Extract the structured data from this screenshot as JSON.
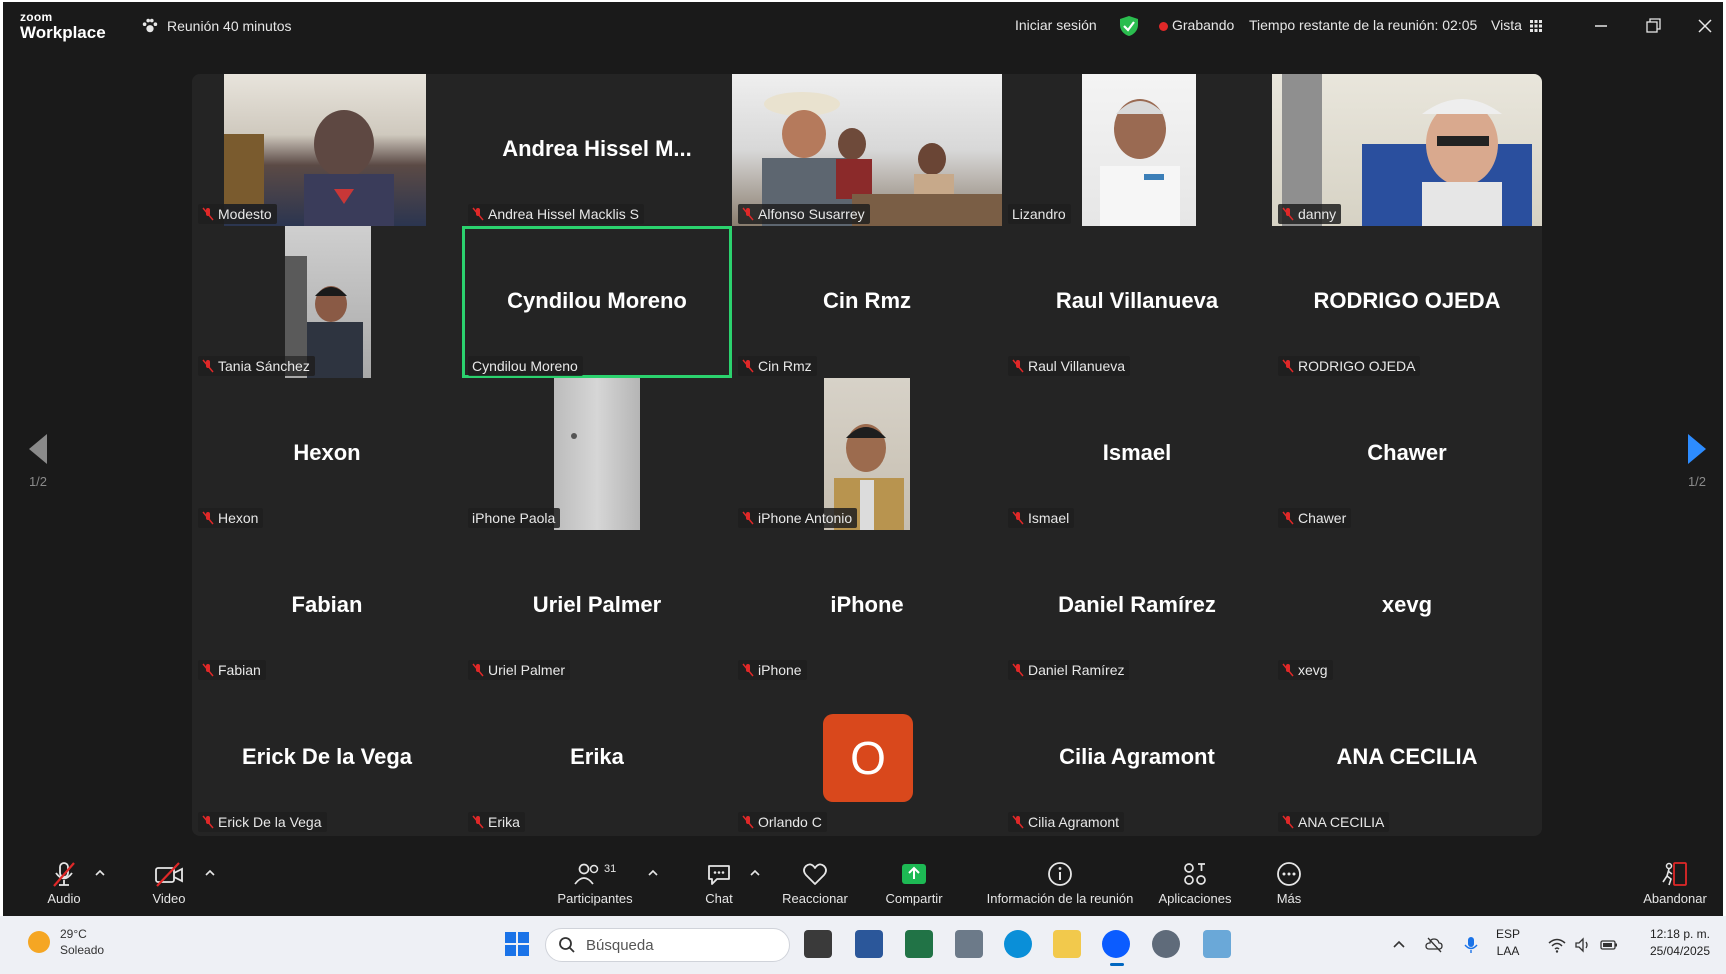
{
  "titlebar": {
    "logo_small": "zoom",
    "logo_big": "Workplace",
    "meeting_title": "Reunión 40 minutos",
    "signin": "Iniciar sesión",
    "recording": "Grabando",
    "time_left": "Tiempo restante de la reunión: 02:05",
    "view": "Vista"
  },
  "gallery": {
    "page_left": "1/2",
    "page_right": "1/2",
    "tiles": [
      {
        "label": "Modesto",
        "big": "",
        "muted": true
      },
      {
        "label": "Andrea Hissel Macklis S",
        "big": "Andrea  Hissel  M...",
        "muted": true
      },
      {
        "label": "Alfonso Susarrey",
        "big": "",
        "muted": true
      },
      {
        "label": "Lizandro",
        "big": "",
        "muted": false
      },
      {
        "label": "danny",
        "big": "",
        "muted": true
      },
      {
        "label": "Tania Sánchez",
        "big": "",
        "muted": true
      },
      {
        "label": "Cyndilou Moreno",
        "big": "Cyndilou Moreno",
        "muted": false
      },
      {
        "label": "Cin Rmz",
        "big": "Cin Rmz",
        "muted": true
      },
      {
        "label": "Raul Villanueva",
        "big": "Raul Villanueva",
        "muted": true
      },
      {
        "label": "RODRIGO OJEDA",
        "big": "RODRIGO OJEDA",
        "muted": true
      },
      {
        "label": "Hexon",
        "big": "Hexon",
        "muted": true
      },
      {
        "label": "iPhone Paola",
        "big": "",
        "muted": false
      },
      {
        "label": "iPhone Antonio",
        "big": "",
        "muted": true
      },
      {
        "label": "Ismael",
        "big": "Ismael",
        "muted": true
      },
      {
        "label": "Chawer",
        "big": "Chawer",
        "muted": true
      },
      {
        "label": "Fabian",
        "big": "Fabian",
        "muted": true
      },
      {
        "label": "Uriel Palmer",
        "big": "Uriel Palmer",
        "muted": true
      },
      {
        "label": "iPhone",
        "big": "iPhone",
        "muted": true
      },
      {
        "label": "Daniel Ramírez",
        "big": "Daniel Ramírez",
        "muted": true
      },
      {
        "label": "xevg",
        "big": "xevg",
        "muted": true
      },
      {
        "label": "Erick De la Vega",
        "big": "Erick De la Vega",
        "muted": true
      },
      {
        "label": "Erika",
        "big": "Erika",
        "muted": true
      },
      {
        "label": "Orlando C",
        "big": "",
        "avatar": "O",
        "muted": true
      },
      {
        "label": "Cilia Agramont",
        "big": "Cilia Agramont",
        "muted": true
      },
      {
        "label": "ANA CECILIA",
        "big": "ANA CECILIA",
        "muted": true
      }
    ]
  },
  "toolbar": {
    "audio": "Audio",
    "video": "Video",
    "participants": "Participantes",
    "participants_count": "31",
    "chat": "Chat",
    "react": "Reaccionar",
    "share": "Compartir",
    "info": "Información de la reunión",
    "apps": "Aplicaciones",
    "more": "Más",
    "leave": "Abandonar"
  },
  "taskbar": {
    "temp": "29°C",
    "weather": "Soleado",
    "search_placeholder": "Búsqueda",
    "lang1": "ESP",
    "lang2": "LAA",
    "time": "12:18 p. m.",
    "date": "25/04/2025"
  },
  "colors": {
    "active_speaker": "#2bd26e",
    "recording": "#e02828",
    "share_green": "#1db954",
    "avatar_orange": "#d9481c"
  }
}
